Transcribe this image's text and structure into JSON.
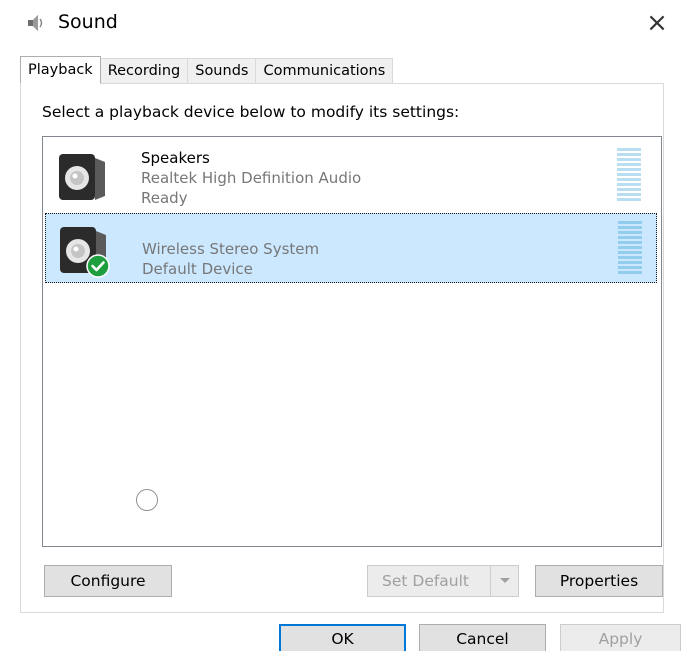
{
  "window": {
    "title": "Sound",
    "close_glyph": "×",
    "title_icon": "speaker-icon"
  },
  "tabs": [
    {
      "label": "Playback",
      "active": true
    },
    {
      "label": "Recording",
      "active": false
    },
    {
      "label": "Sounds",
      "active": false
    },
    {
      "label": "Communications",
      "active": false
    }
  ],
  "instruction": "Select a playback device below to modify its settings:",
  "devices": [
    {
      "name": "Speakers",
      "driver": "Realtek High Definition Audio",
      "status": "Ready",
      "selected": false,
      "icon": "speaker-icon"
    },
    {
      "name": "Wireless Stereo System",
      "status": "Default Device",
      "selected": true,
      "default": true,
      "icon": "speaker-default-icon"
    }
  ],
  "buttons": {
    "configure": "Configure",
    "set_default": "Set Default",
    "properties": "Properties",
    "ok": "OK",
    "cancel": "Cancel",
    "apply": "Apply"
  },
  "colors": {
    "selection": "#cce8ff",
    "accent": "#0078d7",
    "default_check": "#1e9e3e"
  }
}
